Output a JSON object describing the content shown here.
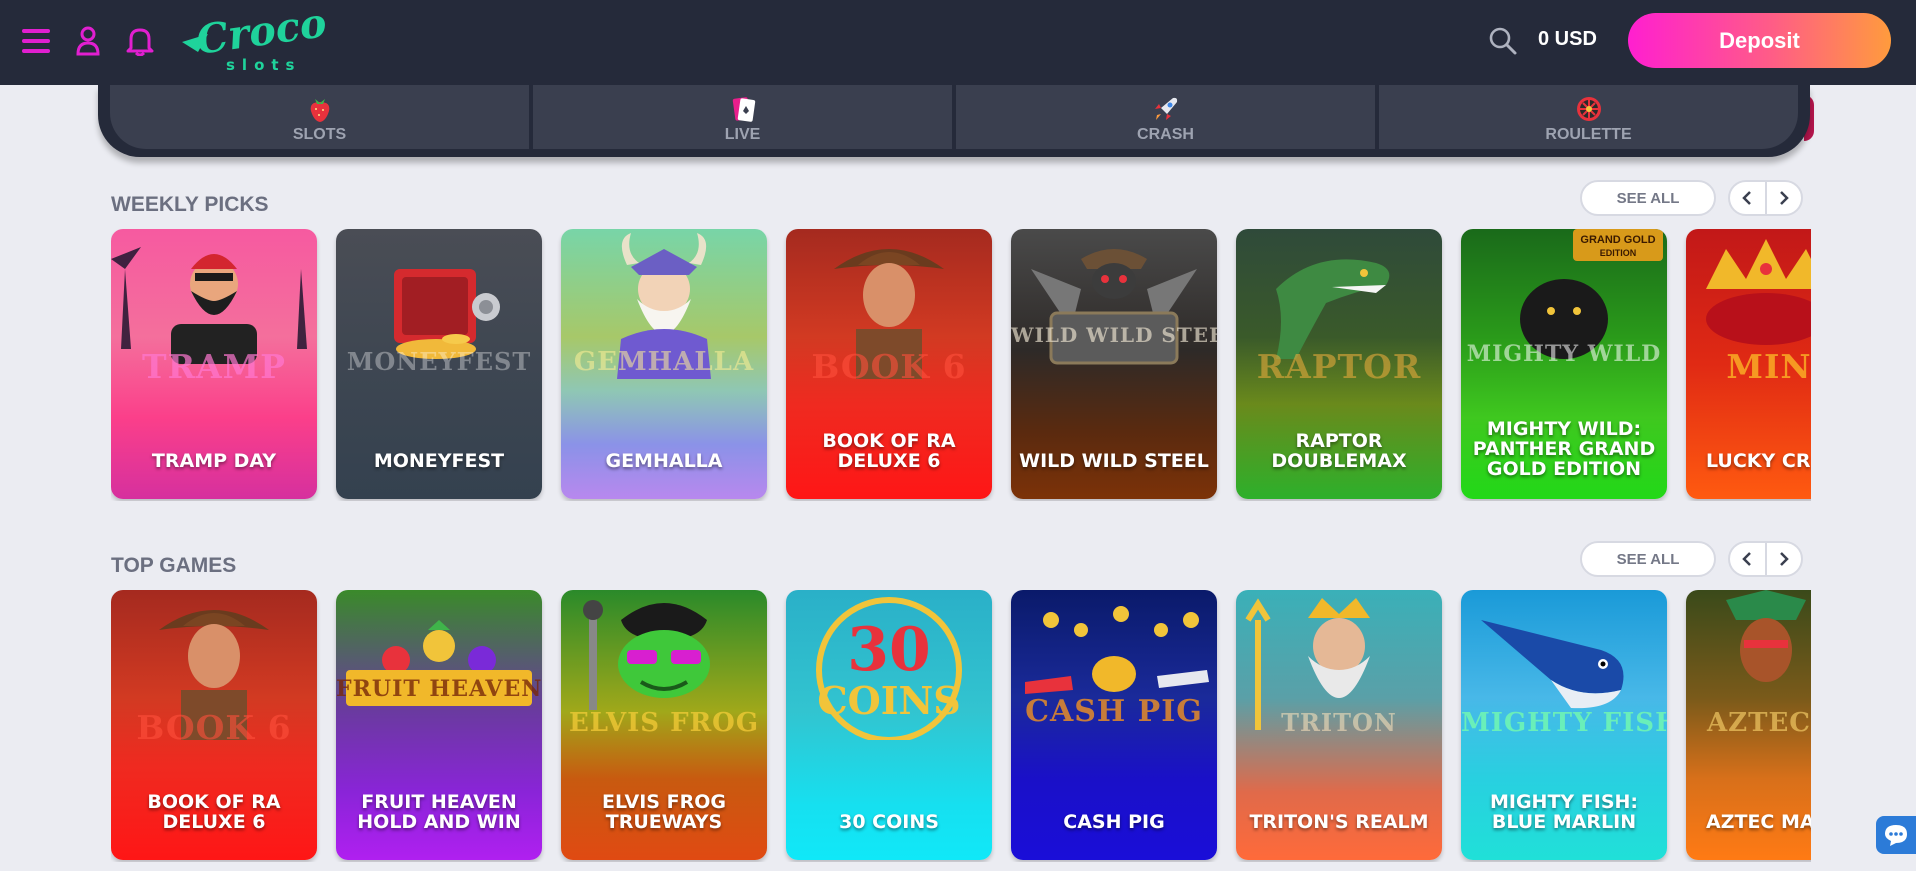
{
  "header": {
    "menu_icon": "menu-icon",
    "profile_icon": "user-icon",
    "notifications_icon": "bell-icon",
    "logo_word": "Croco",
    "logo_sub": "slots",
    "search_icon": "search-icon",
    "balance": "0 USD",
    "deposit_label": "Deposit",
    "accent": "#e11fd0",
    "brand": "#1fd39b"
  },
  "categories": [
    {
      "label": "SLOTS",
      "icon": "strawberry-icon"
    },
    {
      "label": "LIVE",
      "icon": "cards-icon"
    },
    {
      "label": "CRASH",
      "icon": "rocket-icon"
    },
    {
      "label": "ROULETTE",
      "icon": "roulette-icon"
    }
  ],
  "weekly": {
    "title": "WEEKLY PICKS",
    "see_all": "SEE ALL",
    "games": [
      {
        "name": "TRAMP DAY",
        "logo": "TRAMP"
      },
      {
        "name": "MONEYFEST",
        "logo": "MONEYFEST"
      },
      {
        "name": "GEMHALLA",
        "logo": "GEMHALLA"
      },
      {
        "name": "BOOK OF RA DELUXE 6",
        "logo": "BOOK 6"
      },
      {
        "name": "WILD WILD STEEL",
        "logo": "WILD WILD STEEL"
      },
      {
        "name": "RAPTOR DOUBLEMAX",
        "logo": "RAPTOR"
      },
      {
        "name": "MIGHTY WILD: PANTHER GRAND GOLD EDITION",
        "logo": "MIGHTY WILD"
      },
      {
        "name": "LUCKY CR HOLD AND",
        "logo": "MIN"
      }
    ]
  },
  "top": {
    "title": "TOP GAMES",
    "see_all": "SEE ALL",
    "games": [
      {
        "name": "BOOK OF RA DELUXE 6",
        "logo": "BOOK 6"
      },
      {
        "name": "FRUIT HEAVEN HOLD AND WIN",
        "logo": "FRUIT HEAVEN"
      },
      {
        "name": "ELVIS FROG TRUEWAYS",
        "logo": "ELVIS FROG"
      },
      {
        "name": "30 COINS",
        "logo": "30 COINS"
      },
      {
        "name": "CASH PIG",
        "logo": "CASH PIG"
      },
      {
        "name": "TRITON'S REALM",
        "logo": "TRITON"
      },
      {
        "name": "MIGHTY FISH: BLUE MARLIN",
        "logo": "MIGHTY FISH"
      },
      {
        "name": "AZTEC MA BONAN",
        "logo": "AZTEC"
      }
    ]
  },
  "chat_icon": "chat-bubble-icon"
}
